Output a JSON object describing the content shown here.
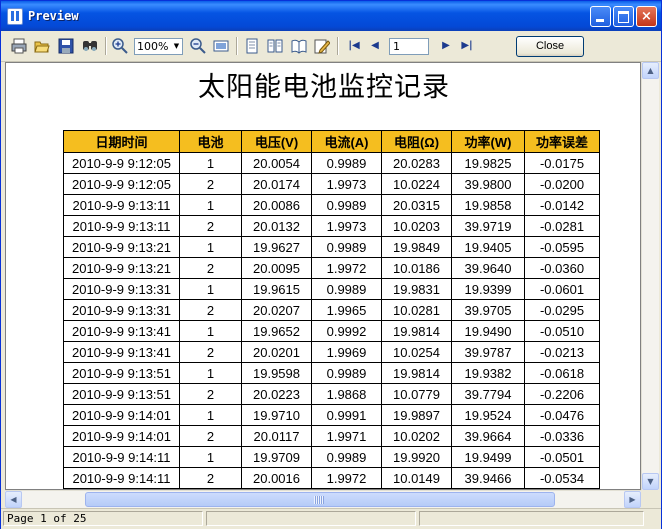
{
  "window": {
    "title": "Preview",
    "buttons": {
      "minimize": "minimize",
      "maximize": "maximize",
      "close": "×"
    }
  },
  "toolbar": {
    "icons": [
      "print-icon",
      "open-icon",
      "save-icon",
      "find-icon",
      "zoom-in-icon",
      "zoom-out-icon",
      "page-width-icon",
      "single-page-icon",
      "multi-page-icon",
      "book-view-icon",
      "edit-icon"
    ],
    "zoom_value": "100%",
    "page_value": "1",
    "close_label": "Close"
  },
  "document": {
    "title": "太阳能电池监控记录",
    "headers": [
      "日期时间",
      "电池",
      "电压(V)",
      "电流(A)",
      "电阻(Ω)",
      "功率(W)",
      "功率误差"
    ],
    "rows": [
      [
        "2010-9-9 9:12:05",
        "1",
        "20.0054",
        "0.9989",
        "20.0283",
        "19.9825",
        "-0.0175"
      ],
      [
        "2010-9-9 9:12:05",
        "2",
        "20.0174",
        "1.9973",
        "10.0224",
        "39.9800",
        "-0.0200"
      ],
      [
        "2010-9-9 9:13:11",
        "1",
        "20.0086",
        "0.9989",
        "20.0315",
        "19.9858",
        "-0.0142"
      ],
      [
        "2010-9-9 9:13:11",
        "2",
        "20.0132",
        "1.9973",
        "10.0203",
        "39.9719",
        "-0.0281"
      ],
      [
        "2010-9-9 9:13:21",
        "1",
        "19.9627",
        "0.9989",
        "19.9849",
        "19.9405",
        "-0.0595"
      ],
      [
        "2010-9-9 9:13:21",
        "2",
        "20.0095",
        "1.9972",
        "10.0186",
        "39.9640",
        "-0.0360"
      ],
      [
        "2010-9-9 9:13:31",
        "1",
        "19.9615",
        "0.9989",
        "19.9831",
        "19.9399",
        "-0.0601"
      ],
      [
        "2010-9-9 9:13:31",
        "2",
        "20.0207",
        "1.9965",
        "10.0281",
        "39.9705",
        "-0.0295"
      ],
      [
        "2010-9-9 9:13:41",
        "1",
        "19.9652",
        "0.9992",
        "19.9814",
        "19.9490",
        "-0.0510"
      ],
      [
        "2010-9-9 9:13:41",
        "2",
        "20.0201",
        "1.9969",
        "10.0254",
        "39.9787",
        "-0.0213"
      ],
      [
        "2010-9-9 9:13:51",
        "1",
        "19.9598",
        "0.9989",
        "19.9814",
        "19.9382",
        "-0.0618"
      ],
      [
        "2010-9-9 9:13:51",
        "2",
        "20.0223",
        "1.9868",
        "10.0779",
        "39.7794",
        "-0.2206"
      ],
      [
        "2010-9-9 9:14:01",
        "1",
        "19.9710",
        "0.9991",
        "19.9897",
        "19.9524",
        "-0.0476"
      ],
      [
        "2010-9-9 9:14:01",
        "2",
        "20.0117",
        "1.9971",
        "10.0202",
        "39.9664",
        "-0.0336"
      ],
      [
        "2010-9-9 9:14:11",
        "1",
        "19.9709",
        "0.9989",
        "19.9920",
        "19.9499",
        "-0.0501"
      ],
      [
        "2010-9-9 9:14:11",
        "2",
        "20.0016",
        "1.9972",
        "10.0149",
        "39.9466",
        "-0.0534"
      ]
    ]
  },
  "status": {
    "page_text": "Page 1 of 25"
  }
}
